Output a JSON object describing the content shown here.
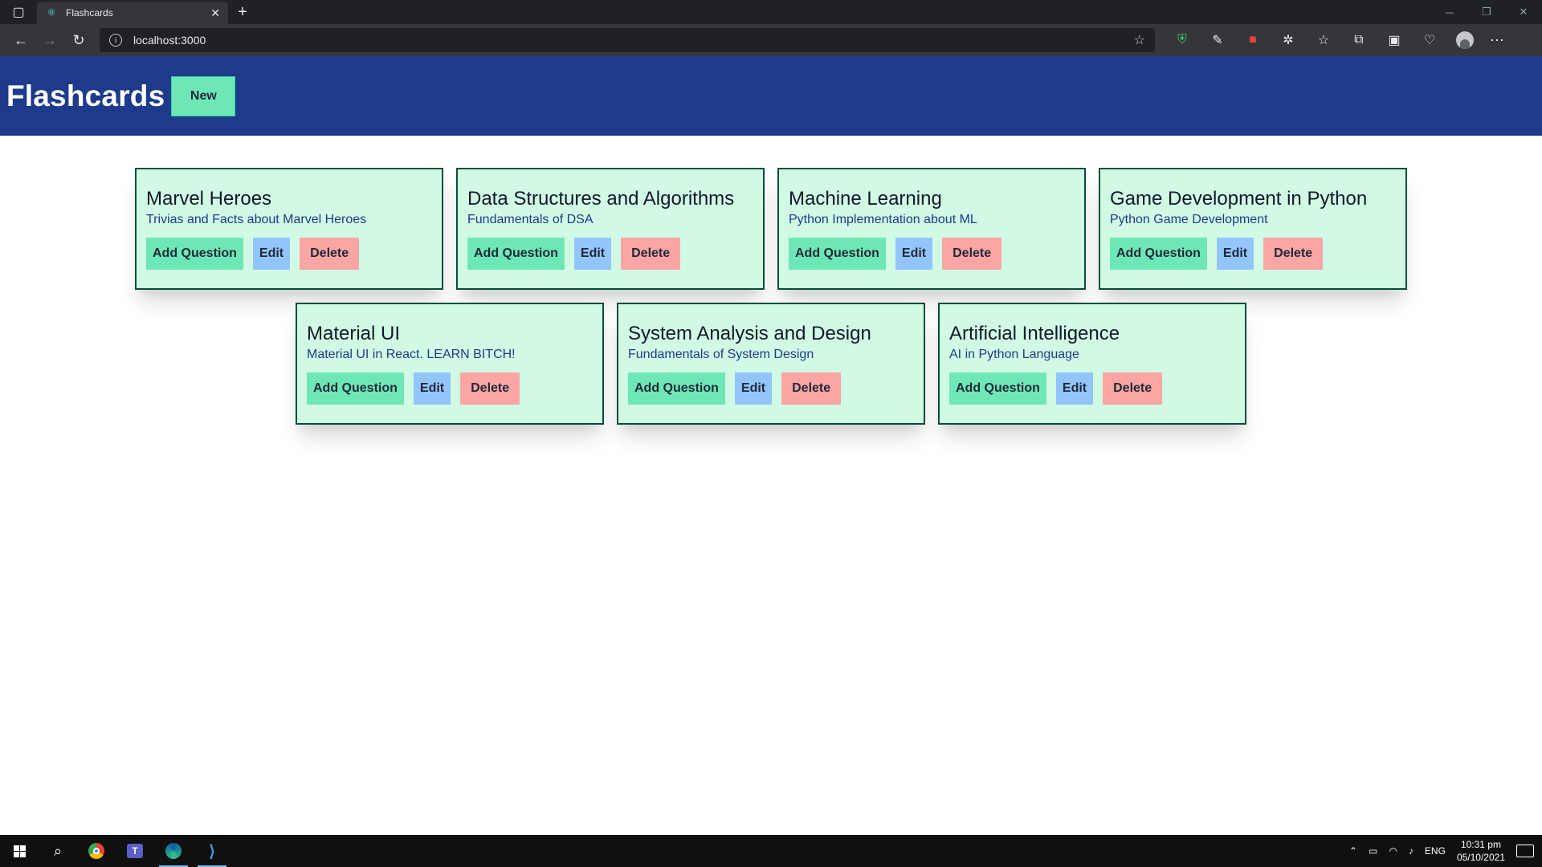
{
  "browser": {
    "tab_title": "Flashcards",
    "url": "localhost:3000"
  },
  "header": {
    "title": "Flashcards",
    "new_button_label": "New"
  },
  "card_buttons": {
    "add": "Add Question",
    "edit": "Edit",
    "delete": "Delete"
  },
  "decks": [
    {
      "title": "Marvel Heroes",
      "description": "Trivias and Facts about Marvel Heroes"
    },
    {
      "title": "Data Structures and Algorithms",
      "description": "Fundamentals of DSA"
    },
    {
      "title": "Machine Learning",
      "description": "Python Implementation about ML"
    },
    {
      "title": "Game Development in Python",
      "description": "Python Game Development"
    },
    {
      "title": "Material UI",
      "description": "Material UI in React. LEARN BITCH!"
    },
    {
      "title": "System Analysis and Design",
      "description": "Fundamentals of System Design"
    },
    {
      "title": "Artificial Intelligence",
      "description": "AI in Python Language"
    }
  ],
  "taskbar": {
    "language": "ENG",
    "time": "10:31 pm",
    "date": "05/10/2021"
  },
  "colors": {
    "header_bg": "#1e3a8a",
    "card_bg": "#d1fae5",
    "add_button": "#6ee7b7",
    "edit_button": "#93c5fd",
    "delete_button": "#fca5a5"
  }
}
